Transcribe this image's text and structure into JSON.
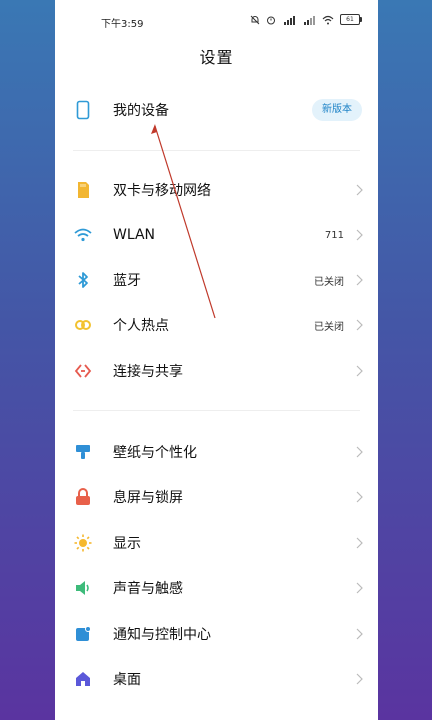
{
  "status_bar": {
    "time": "下午3:59",
    "battery": "61"
  },
  "page": {
    "title": "设置"
  },
  "device": {
    "label": "我的设备",
    "badge": "新版本"
  },
  "group1": [
    {
      "id": "sim",
      "label": "双卡与移动网络",
      "value": ""
    },
    {
      "id": "wlan",
      "label": "WLAN",
      "value": "711"
    },
    {
      "id": "bluetooth",
      "label": "蓝牙",
      "value": "已关闭"
    },
    {
      "id": "hotspot",
      "label": "个人热点",
      "value": "已关闭"
    },
    {
      "id": "share",
      "label": "连接与共享",
      "value": ""
    }
  ],
  "group2": [
    {
      "id": "wallpaper",
      "label": "壁纸与个性化"
    },
    {
      "id": "lockscreen",
      "label": "息屏与锁屏"
    },
    {
      "id": "display",
      "label": "显示"
    },
    {
      "id": "sound",
      "label": "声音与触感"
    },
    {
      "id": "notification",
      "label": "通知与控制中心"
    },
    {
      "id": "desktop",
      "label": "桌面"
    }
  ],
  "colors": {
    "accent_blue": "#1e83c7",
    "sim_yellow": "#f2b632",
    "wlan_blue": "#2f9ad6",
    "bluetooth_blue": "#2f9ad6",
    "hotspot_yellow": "#f2c230",
    "share_red": "#e65a4f",
    "wallpaper_blue": "#2f8fd6",
    "lock_red": "#e8604a",
    "display_yellow": "#f5b82e",
    "sound_green": "#3dbb7a",
    "notify_blue": "#2f8fd6",
    "desktop_purple": "#5b58d9",
    "annotation_red": "#c0392b"
  }
}
